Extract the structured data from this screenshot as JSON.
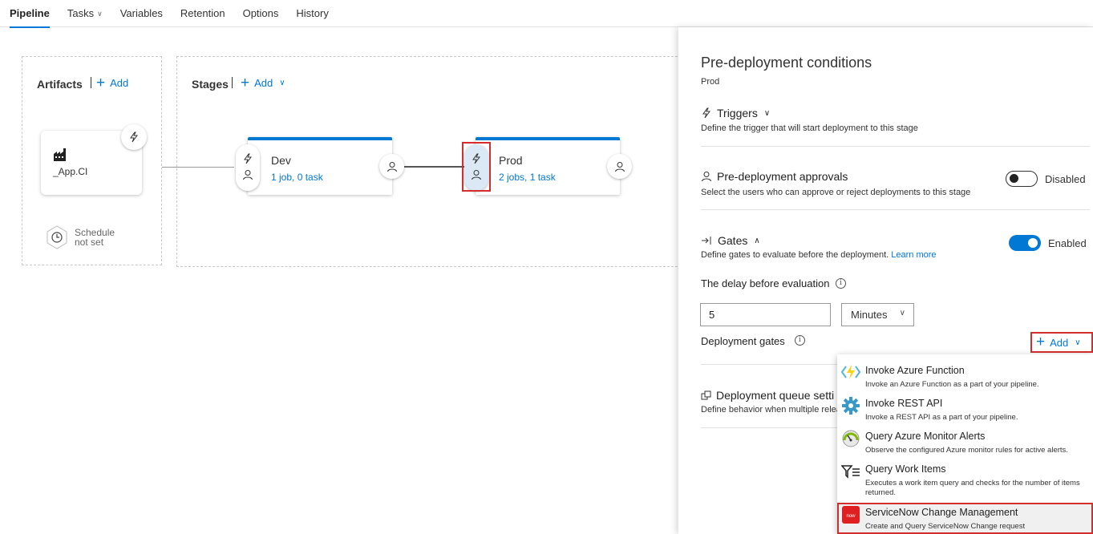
{
  "tabs": [
    {
      "label": "Pipeline",
      "active": true
    },
    {
      "label": "Tasks",
      "dropdown": true
    },
    {
      "label": "Variables"
    },
    {
      "label": "Retention"
    },
    {
      "label": "Options"
    },
    {
      "label": "History"
    }
  ],
  "artifacts": {
    "title": "Artifacts",
    "add_label": "Add",
    "artifact_name": "_App.CI",
    "schedule_line1": "Schedule",
    "schedule_line2": "not set"
  },
  "stages": {
    "title": "Stages",
    "add_label": "Add",
    "items": [
      {
        "name": "Dev",
        "summary": "1 job, 0 task"
      },
      {
        "name": "Prod",
        "summary": "2 jobs, 1 task"
      }
    ]
  },
  "panel": {
    "title": "Pre-deployment conditions",
    "subtitle": "Prod",
    "triggers": {
      "title": "Triggers",
      "desc": "Define the trigger that will start deployment to this stage"
    },
    "approvals": {
      "title": "Pre-deployment approvals",
      "desc": "Select the users who can approve or reject deployments to this stage",
      "toggle_label": "Disabled",
      "enabled": false
    },
    "gates": {
      "title": "Gates",
      "desc": "Define gates to evaluate before the deployment.",
      "learn_more": "Learn more",
      "toggle_label": "Enabled",
      "enabled": true
    },
    "delay_label": "The delay before evaluation",
    "delay_value": "5",
    "delay_unit": "Minutes",
    "deployment_gates_label": "Deployment gates",
    "add_label": "Add",
    "queue": {
      "title": "Deployment queue setti",
      "desc": "Define behavior when multiple relea"
    }
  },
  "gate_menu": [
    {
      "title": "Invoke Azure Function",
      "desc": "Invoke an Azure Function as a part of your pipeline.",
      "icon": "azure-function-icon"
    },
    {
      "title": "Invoke REST API",
      "desc": "Invoke a REST API as a part of your pipeline.",
      "icon": "gear-icon"
    },
    {
      "title": "Query Azure Monitor Alerts",
      "desc": "Observe the configured Azure monitor rules for active alerts.",
      "icon": "monitor-gauge-icon"
    },
    {
      "title": "Query Work Items",
      "desc": "Executes a work item query and checks for the number of items returned.",
      "icon": "filter-list-icon"
    },
    {
      "title": "ServiceNow Change Management",
      "desc": "Create and Query ServiceNow Change request",
      "icon": "servicenow-icon",
      "highlighted": true
    }
  ],
  "colors": {
    "accent": "#0078d4",
    "highlight_border": "#d42d2d"
  }
}
